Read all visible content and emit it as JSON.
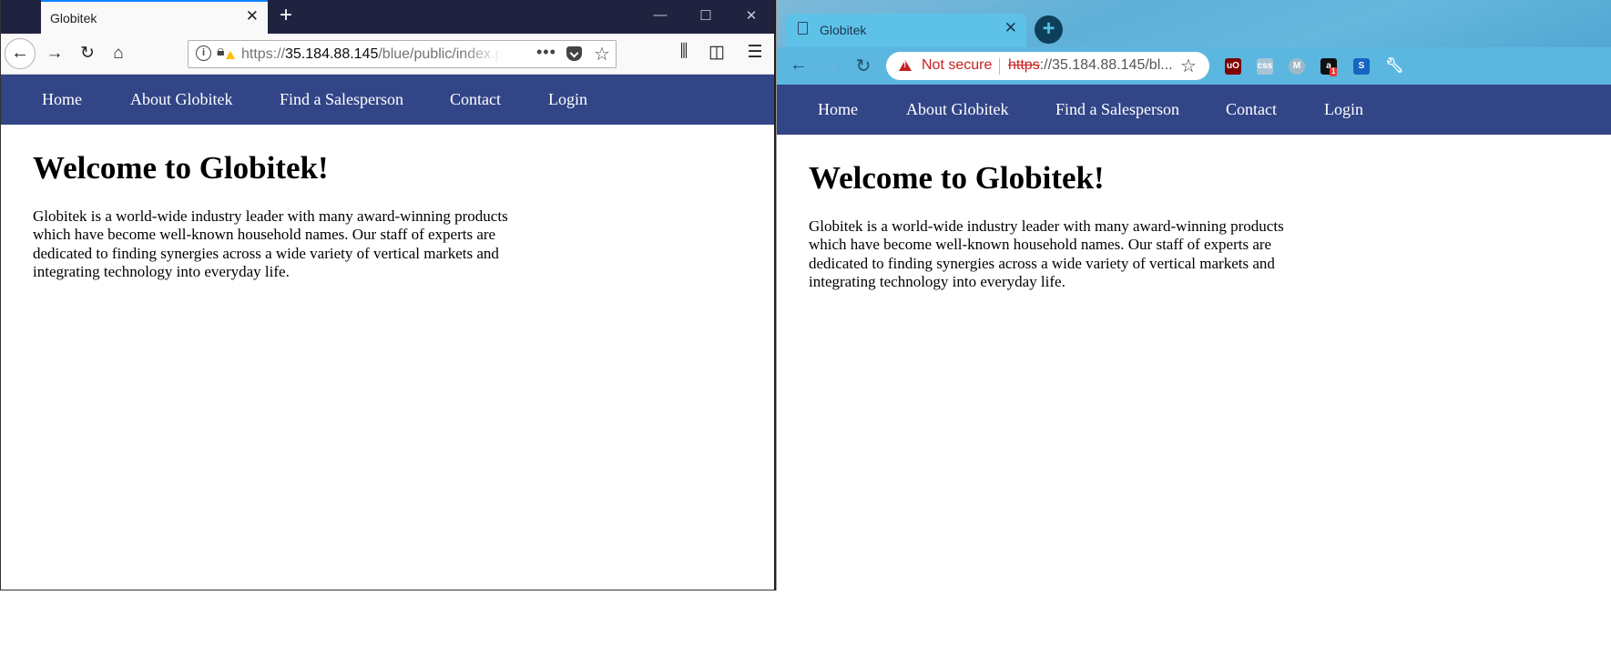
{
  "firefox": {
    "tab_title": "Globitek",
    "url_proto": "https://",
    "url_host": "35.184.88.145",
    "url_path": "/blue/public/index.p"
  },
  "chrome": {
    "tab_title": "Globitek",
    "security_label": "Not secure",
    "url_proto": "https",
    "url_rest": "://35.184.88.145/bl...",
    "ext_badge": "1"
  },
  "site": {
    "nav": [
      "Home",
      "About Globitek",
      "Find a Salesperson",
      "Contact",
      "Login"
    ],
    "heading": "Welcome to Globitek!",
    "intro": "Globitek is a world-wide industry leader with many award-winning products which have become well-known household names. Our staff of experts are dedicated to finding synergies across a wide variety of vertical markets and integrating technology into everyday life."
  },
  "colors": {
    "nav_bg": "#324587",
    "ff_titlebar": "#202340",
    "chrome_theme": "#5bb7e0",
    "not_secure": "#c5221f"
  }
}
